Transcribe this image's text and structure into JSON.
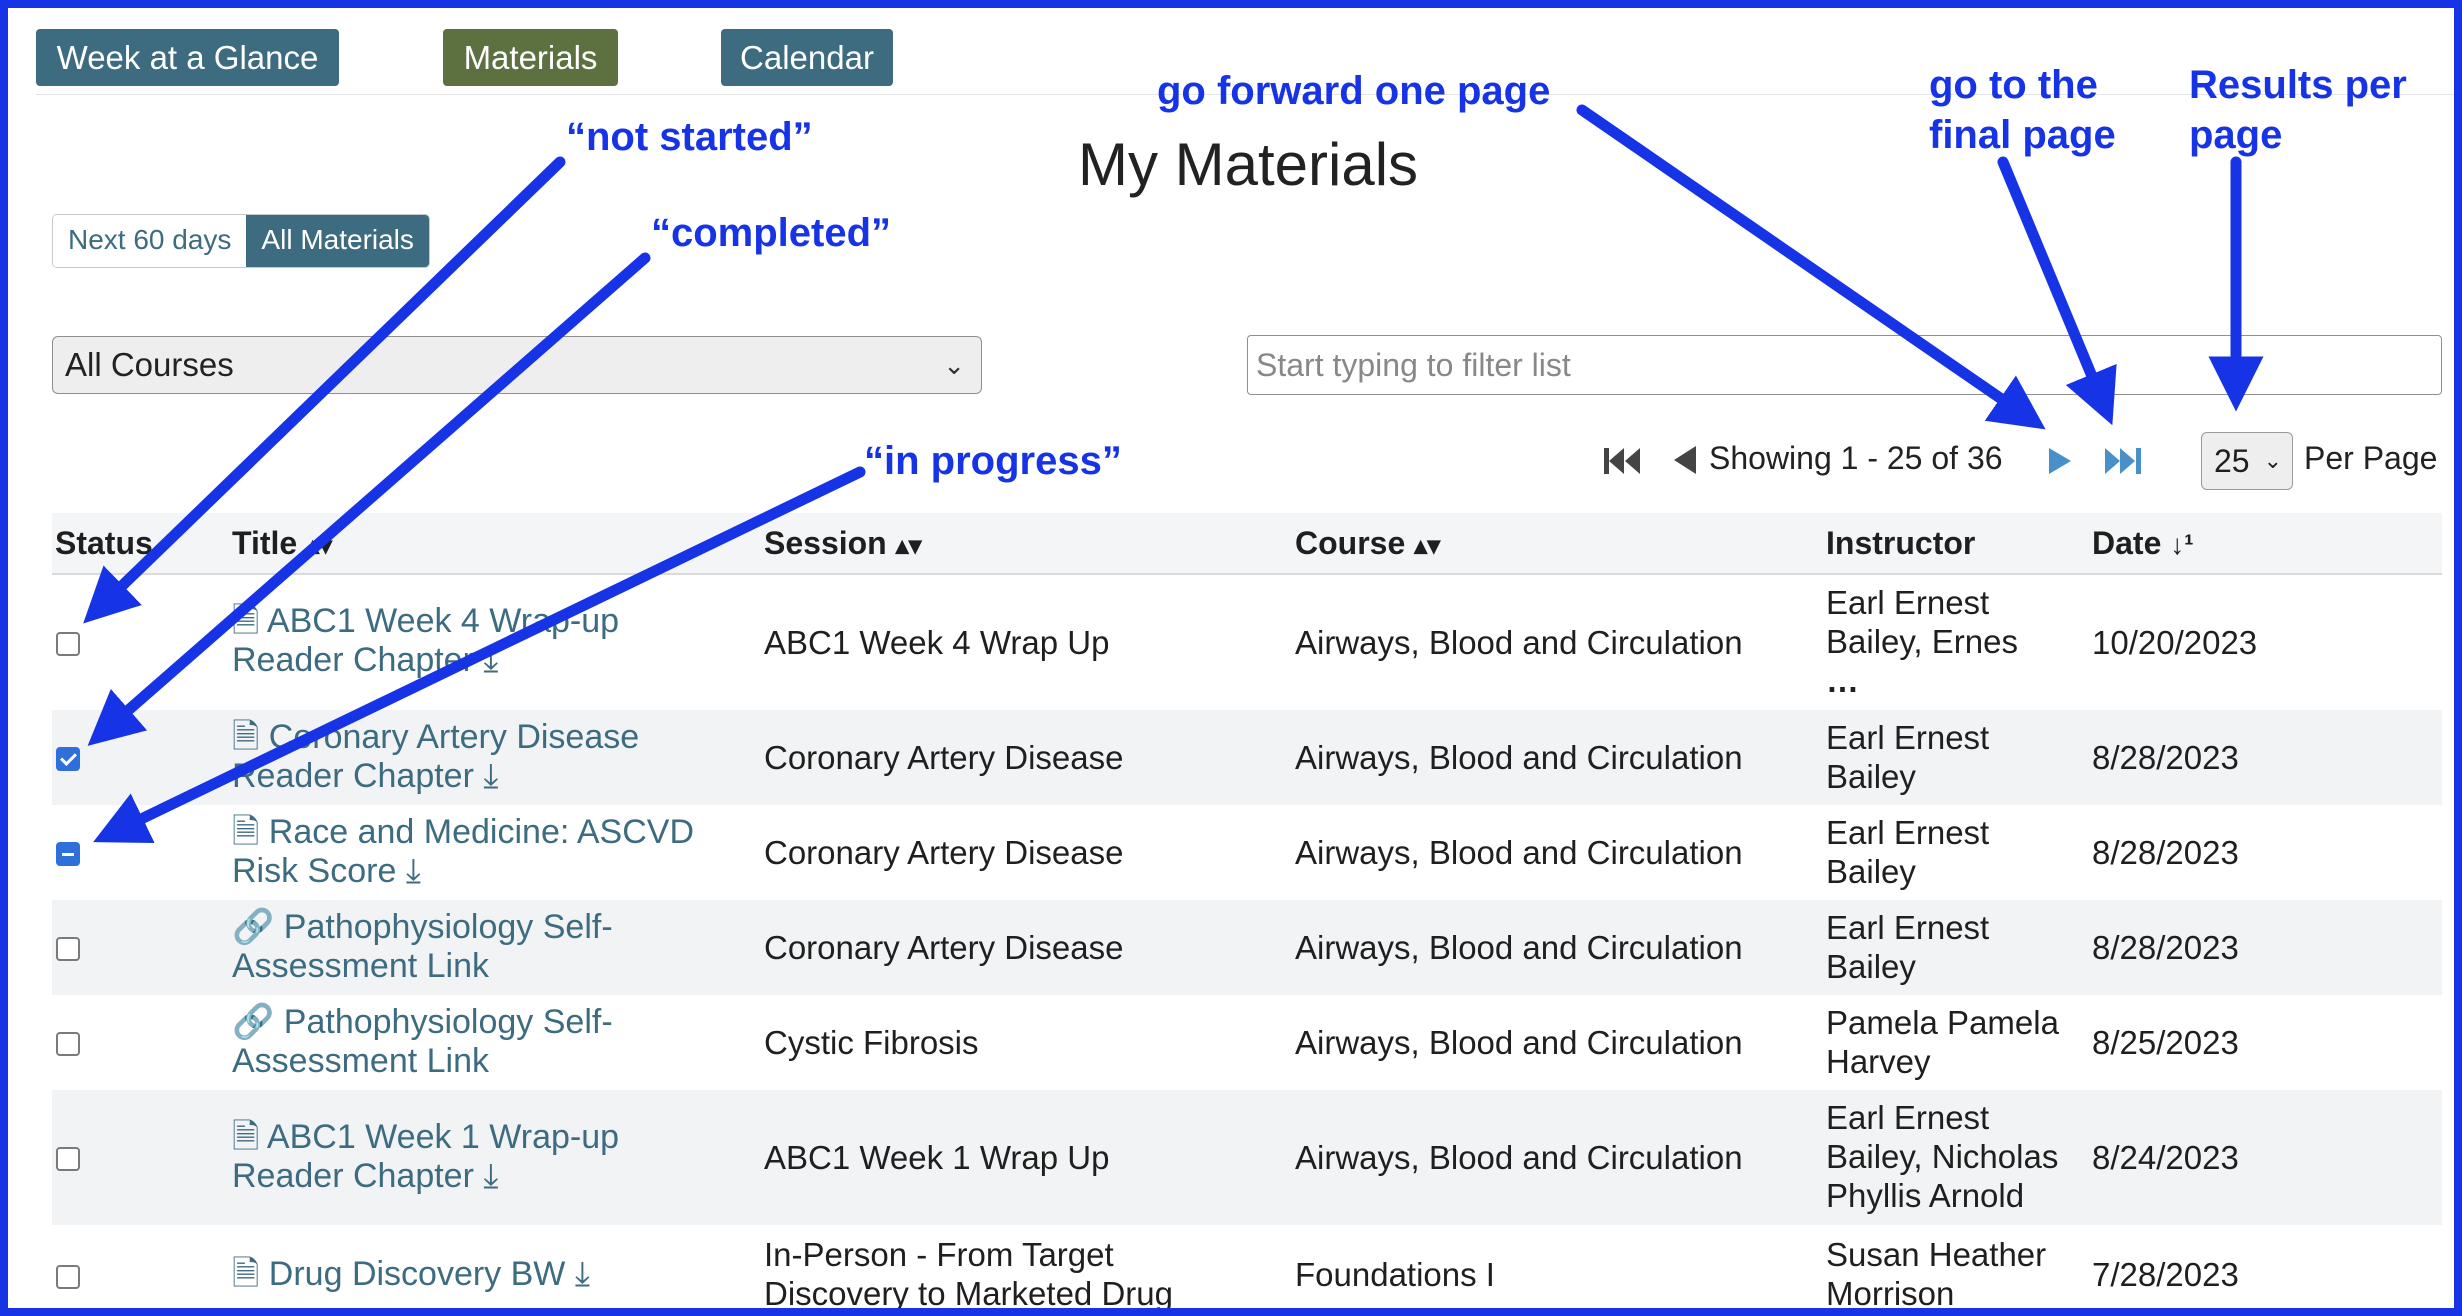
{
  "nav": {
    "tabs": [
      {
        "label": "Week at a Glance",
        "color": "#3d6b80"
      },
      {
        "label": "Materials",
        "color": "#5d7040"
      },
      {
        "label": "Calendar",
        "color": "#3d6b80"
      }
    ]
  },
  "page": {
    "title": "My Materials"
  },
  "range_toggle": {
    "option_a": "Next 60 days",
    "option_b": "All Materials",
    "active": "All Materials"
  },
  "course_filter": {
    "selected": "All Courses"
  },
  "search": {
    "placeholder": "Start typing to filter list"
  },
  "pagination": {
    "status": "Showing 1 - 25 of 36",
    "per_page": "25",
    "per_page_label": "Per Page"
  },
  "table": {
    "headers": {
      "status": "Status",
      "title": "Title",
      "session": "Session",
      "course": "Course",
      "instructor": "Instructor",
      "date": "Date"
    },
    "rows": [
      {
        "status": "not started",
        "icon": "pdf",
        "title_l1": "ABC1 Week 4 Wrap-up",
        "title_l2": "Reader Chapter",
        "session_l1": "ABC1 Week 4 Wrap Up",
        "session_l2": "",
        "course": "Airways, Blood and Circulation",
        "inst_l1": "Earl Ernest",
        "inst_l2": "Bailey, Ernes",
        "inst_l3": "",
        "date": "10/20/2023"
      },
      {
        "status": "completed",
        "icon": "pdf",
        "title_l1": "Coronary Artery Disease",
        "title_l2": "Reader Chapter",
        "session_l1": "Coronary Artery Disease",
        "session_l2": "",
        "course": "Airways, Blood and Circulation",
        "inst_l1": "Earl Ernest",
        "inst_l2": "Bailey",
        "inst_l3": "",
        "date": "8/28/2023"
      },
      {
        "status": "in progress",
        "icon": "pdf",
        "title_l1": "Race and Medicine: ASCVD",
        "title_l2": "Risk Score",
        "session_l1": "Coronary Artery Disease",
        "session_l2": "",
        "course": "Airways, Blood and Circulation",
        "inst_l1": "Earl Ernest",
        "inst_l2": "Bailey",
        "inst_l3": "",
        "date": "8/28/2023"
      },
      {
        "status": "not started",
        "icon": "link",
        "title_l1": "Pathophysiology Self-",
        "title_l2": "Assessment Link",
        "session_l1": "Coronary Artery Disease",
        "session_l2": "",
        "course": "Airways, Blood and Circulation",
        "inst_l1": "Earl Ernest",
        "inst_l2": "Bailey",
        "inst_l3": "",
        "date": "8/28/2023"
      },
      {
        "status": "not started",
        "icon": "link",
        "title_l1": "Pathophysiology Self-",
        "title_l2": "Assessment Link",
        "session_l1": "Cystic Fibrosis",
        "session_l2": "",
        "course": "Airways, Blood and Circulation",
        "inst_l1": "Pamela Pamela",
        "inst_l2": "Harvey",
        "inst_l3": "",
        "date": "8/25/2023"
      },
      {
        "status": "not started",
        "icon": "pdf",
        "title_l1": "ABC1 Week 1 Wrap-up",
        "title_l2": "Reader Chapter",
        "session_l1": "ABC1 Week 1 Wrap Up",
        "session_l2": "",
        "course": "Airways, Blood and Circulation",
        "inst_l1": "Earl Ernest",
        "inst_l2": "Bailey, Nicholas",
        "inst_l3": "Phyllis Arnold",
        "date": "8/24/2023"
      },
      {
        "status": "not started",
        "icon": "pdf",
        "title_l1": "Drug Discovery BW",
        "title_l2": "",
        "session_l1": "In-Person - From Target",
        "session_l2": "Discovery to Marketed Drug",
        "course": "Foundations I",
        "inst_l1": "Susan Heather",
        "inst_l2": "Morrison",
        "inst_l3": "",
        "date": "7/28/2023"
      }
    ]
  },
  "annotations": {
    "not_started": "“not started”",
    "completed": "“completed”",
    "in_progress": "“in progress”",
    "forward": "go forward one page",
    "final_l1": "go to the",
    "final_l2": "final page",
    "results_l1": "Results per",
    "results_l2": "page",
    "color": "#1733e6"
  }
}
